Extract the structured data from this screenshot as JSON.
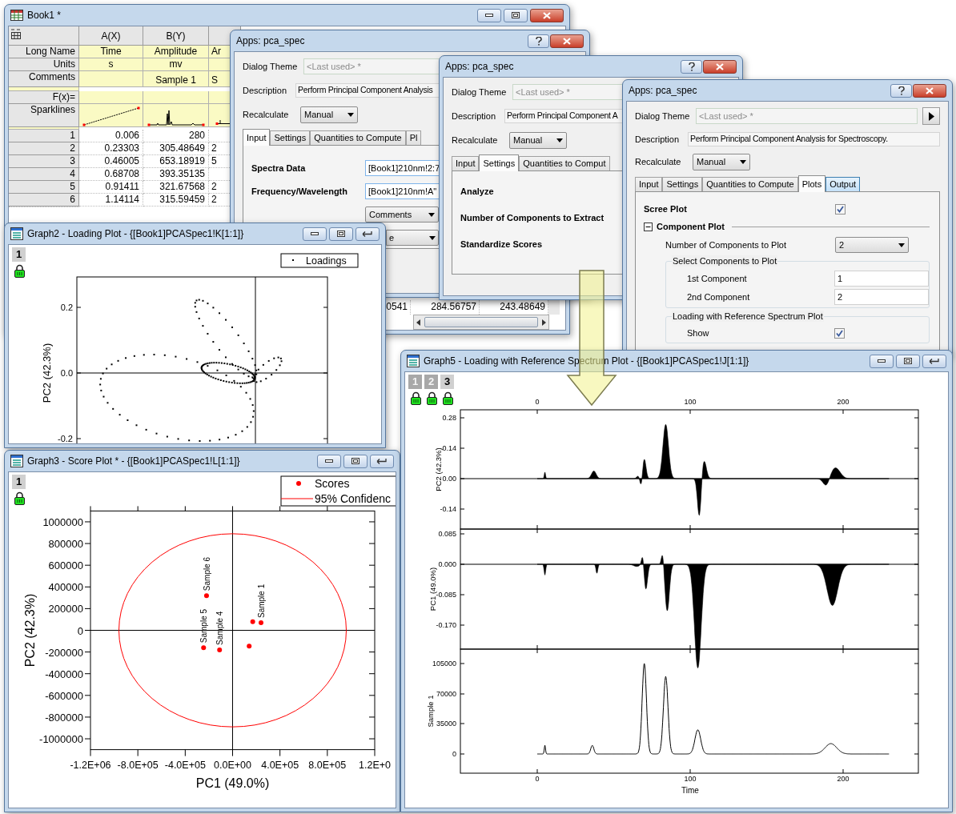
{
  "book": {
    "title": "Book1 *",
    "columns": [
      "A(X)",
      "B(Y)"
    ],
    "label_rows": [
      {
        "kind": "text",
        "label": "Long Name",
        "cells": [
          "Time",
          "Amplitude",
          "Ar"
        ]
      },
      {
        "kind": "text",
        "label": "Units",
        "cells": [
          "s",
          "mv"
        ]
      },
      {
        "kind": "text",
        "label": "Comments",
        "cells": [
          null,
          "Sample 1",
          "S"
        ]
      },
      {
        "kind": "text",
        "label": "F(x)="
      },
      {
        "kind": "sparkline",
        "label": "Sparklines"
      }
    ],
    "rows": [
      {
        "index": "1",
        "cells": [
          "0.006",
          "280"
        ]
      },
      {
        "index": "2",
        "cells": [
          "0.23303",
          "305.48649",
          "2"
        ]
      },
      {
        "index": "3",
        "cells": [
          "0.46005",
          "653.18919",
          "5"
        ]
      },
      {
        "index": "4",
        "cells": [
          "0.68708",
          "393.35135"
        ]
      },
      {
        "index": "5",
        "cells": [
          "0.91411",
          "321.67568",
          "2"
        ]
      },
      {
        "index": "6",
        "cells": [
          "1.14114",
          "315.59459",
          "2"
        ]
      }
    ],
    "bottom_row": [
      "0541",
      "284.56757",
      "243.48649"
    ]
  },
  "dialogs": [
    {
      "title": "Apps: pca_spec",
      "theme_label": "Dialog Theme",
      "theme_value": "<Last used> *",
      "description_label": "Description",
      "description": "Perform Principal Component Analysis",
      "recalculate_label": "Recalculate",
      "recalculate_value": "Manual",
      "tabs": [
        {
          "label": "Input",
          "selected": true
        },
        {
          "label": "Settings",
          "selected": false
        },
        {
          "label": "Quantities to Compute",
          "selected": false
        },
        {
          "label": "Pl",
          "selected": false
        }
      ],
      "body": [
        {
          "kind": "text",
          "label": "Spectra Data",
          "value": "[Book1]210nm!2:7"
        },
        {
          "kind": "text",
          "label": "Frequency/Wavelength",
          "value": "[Book1]210nm!A\""
        },
        {
          "kind": "dropdown",
          "value": "Comments"
        },
        {
          "kind": "partial_dropdown",
          "value": "e"
        }
      ]
    },
    {
      "title": "Apps: pca_spec",
      "theme_label": "Dialog Theme",
      "theme_value": "<Last used> *",
      "description_label": "Description",
      "description": "Perform Principal Component A",
      "recalculate_label": "Recalculate",
      "recalculate_value": "Manual",
      "tabs": [
        {
          "label": "Input",
          "selected": false
        },
        {
          "label": "Settings",
          "selected": true
        },
        {
          "label": "Quantities to Comput",
          "selected": false
        }
      ],
      "body": [
        {
          "kind": "heading",
          "label": "Analyze"
        },
        {
          "kind": "heading",
          "label": "Number of Components to Extract"
        },
        {
          "kind": "heading",
          "label": "Standardize Scores"
        }
      ]
    },
    {
      "title": "Apps: pca_spec",
      "theme_label": "Dialog Theme",
      "theme_value": "<Last used> *",
      "description_label": "Description",
      "description": "Perform Principal Component Analysis for Spectroscopy.",
      "recalculate_label": "Recalculate",
      "recalculate_value": "Manual",
      "tabs": [
        {
          "label": "Input",
          "selected": false,
          "highlighted": false
        },
        {
          "label": "Settings",
          "selected": false,
          "highlighted": false
        },
        {
          "label": "Quantities to Compute",
          "selected": false,
          "highlighted": false
        },
        {
          "label": "Plots",
          "selected": true,
          "highlighted": false
        },
        {
          "label": "Output",
          "selected": false,
          "highlighted": true
        }
      ],
      "body": [
        {
          "kind": "check",
          "label": "Scree Plot",
          "checked": true
        },
        {
          "kind": "section",
          "label": "Component Plot",
          "expanded": true,
          "children": [
            {
              "kind": "dropdown",
              "label": "Number of Components to Plot",
              "value": "2"
            },
            {
              "kind": "group",
              "label": "Select Components to Plot",
              "children": [
                {
                  "kind": "text",
                  "label": "1st Component",
                  "value": "1"
                },
                {
                  "kind": "text",
                  "label": "2nd Component",
                  "value": "2"
                }
              ]
            },
            {
              "kind": "group",
              "label": "Loading with Reference Spectrum Plot",
              "children": [
                {
                  "kind": "check",
                  "label": "Show",
                  "checked": true
                }
              ]
            }
          ]
        }
      ]
    }
  ],
  "loading_plot": {
    "title": "Graph2 - Loading Plot - {[Book1]PCASpec1!K[1:1]}",
    "layers": [
      {
        "label": "1",
        "selected": true
      }
    ],
    "legend": "Loadings",
    "ylabel": "PC2 (42.3%)",
    "ytick_labels": [
      "0.2",
      "0.0",
      "-0.2"
    ]
  },
  "score_plot": {
    "title": "Graph3 - Score Plot * - {[Book1]PCASpec1!L[1:1]}",
    "layers": [
      {
        "label": "1",
        "selected": true
      }
    ],
    "legend_line": "95% Confidenc",
    "edge_tick_label": "1.2E+0",
    "chart_data": {
      "type": "scatter",
      "xlabel": "PC1 (49.0%)",
      "ylabel": "PC2 (42.3%)",
      "xlim": [
        -1200000,
        1200000
      ],
      "ylim": [
        -1100000,
        1100000
      ],
      "xticks": [
        {
          "value": -1200000,
          "label": "-1.2E+06"
        },
        {
          "value": -800000,
          "label": "-8.0E+05"
        },
        {
          "value": -400000,
          "label": "-4.0E+05"
        },
        {
          "value": 0,
          "label": "0.0E+00"
        },
        {
          "value": 400000,
          "label": "4.0E+05"
        },
        {
          "value": 800000,
          "label": "8.0E+05"
        }
      ],
      "yticks": [
        1000000,
        800000,
        600000,
        400000,
        200000,
        0,
        -200000,
        -400000,
        -600000,
        -800000,
        -1000000
      ],
      "x": [
        -220000,
        -245000,
        -110000,
        170000,
        240000,
        140000
      ],
      "series": [
        {
          "name": "Scores",
          "color": "#ff0000",
          "values": [
            320000,
            -160000,
            -180000,
            80000,
            70000,
            -145000
          ]
        }
      ],
      "annotations": [
        {
          "x": -220000,
          "y": 320000,
          "text": "Sample 6"
        },
        {
          "x": -245000,
          "y": -160000,
          "text": "Sample 5"
        },
        {
          "x": -110000,
          "y": -180000,
          "text": "Sample 4"
        },
        {
          "x": 240000,
          "y": 70000,
          "text": "Sample 1"
        }
      ]
    }
  },
  "spectra_plot": {
    "title": "Graph5 - Loading with Reference Spectrum Plot - {[Book1]PCASpec1!J[1:1]}",
    "layers": [
      {
        "label": "1",
        "selected": false
      },
      {
        "label": "2",
        "selected": false
      },
      {
        "label": "3",
        "selected": true
      }
    ],
    "top_tick_labels": [
      "0",
      "100",
      "200"
    ],
    "panels": [
      {
        "ylabel": "PC2 (42.3%)",
        "ytick_labels": [
          "0.28",
          "0.14",
          "0.00",
          "-0.14"
        ]
      },
      {
        "ylabel": "PC1 (49.0%)",
        "ytick_labels": [
          "0.085",
          "0.000",
          "-0.085",
          "-0.170"
        ]
      },
      {
        "ylabel": "Sample 1",
        "ytick_labels": [
          "105000",
          "70000",
          "35000",
          "0"
        ]
      }
    ],
    "bottom_tick_labels": [
      "0",
      "100",
      "200"
    ],
    "xlabel": "Time"
  }
}
